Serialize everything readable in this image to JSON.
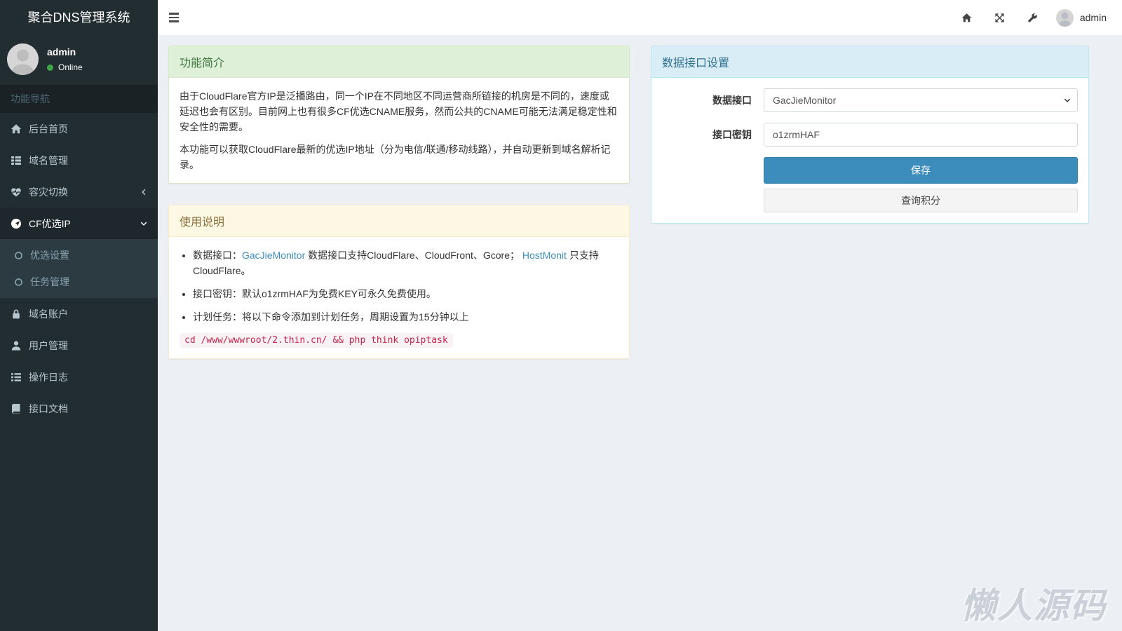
{
  "app": {
    "title": "聚合DNS管理系统"
  },
  "sidebar": {
    "user": {
      "name": "admin",
      "status": "Online"
    },
    "nav_header": "功能导航",
    "items": [
      {
        "label": "后台首页"
      },
      {
        "label": "域名管理"
      },
      {
        "label": "容灾切换"
      },
      {
        "label": "CF优选IP"
      },
      {
        "label": "域名账户"
      },
      {
        "label": "用户管理"
      },
      {
        "label": "操作日志"
      },
      {
        "label": "接口文档"
      }
    ],
    "submenu": [
      {
        "label": "优选设置"
      },
      {
        "label": "任务管理"
      }
    ]
  },
  "navbar": {
    "username": "admin"
  },
  "intro": {
    "title": "功能简介",
    "p1": "由于CloudFlare官方IP是泛播路由，同一个IP在不同地区不同运营商所链接的机房是不同的，速度或延迟也会有区别。目前网上也有很多CF优选CNAME服务，然而公共的CNAME可能无法满足稳定性和安全性的需要。",
    "p2": "本功能可以获取CloudFlare最新的优选IP地址（分为电信/联通/移动线路），并自动更新到域名解析记录。"
  },
  "usage": {
    "title": "使用说明",
    "bullet1_prefix": "数据接口：",
    "bullet1_link1": "GacJieMonitor",
    "bullet1_middle": " 数据接口支持CloudFlare、CloudFront、Gcore； ",
    "bullet1_link2": "HostMonit",
    "bullet1_suffix": " 只支持CloudFlare。",
    "bullet2": "接口密钥：默认o1zrmHAF为免费KEY可永久免费使用。",
    "bullet3": "计划任务：将以下命令添加到计划任务，周期设置为15分钟以上",
    "code": "cd /www/wwwroot/2.thin.cn/ && php think opiptask"
  },
  "settings": {
    "title": "数据接口设置",
    "api_label": "数据接口",
    "api_value": "GacJieMonitor",
    "key_label": "接口密钥",
    "key_value": "o1zrmHAF",
    "save_label": "保存",
    "query_label": "查询积分"
  },
  "watermark": {
    "text": "懒人源码"
  },
  "colors": {
    "accent": "#3c8dbc",
    "sidebar_bg": "#222d32",
    "sidebar_active_bg": "#1e282c",
    "submenu_bg": "#2c3b41",
    "content_bg": "#ecf0f5",
    "success_heading_bg": "#dff0d8",
    "success_heading_text": "#3c763d",
    "warning_heading_bg": "#fcf8e3",
    "warning_heading_text": "#8a6d3b",
    "info_heading_bg": "#d9edf7",
    "info_heading_text": "#31708f",
    "code_text": "#c7254e",
    "code_bg": "#f9f2f4",
    "online_green": "#3fa546"
  }
}
